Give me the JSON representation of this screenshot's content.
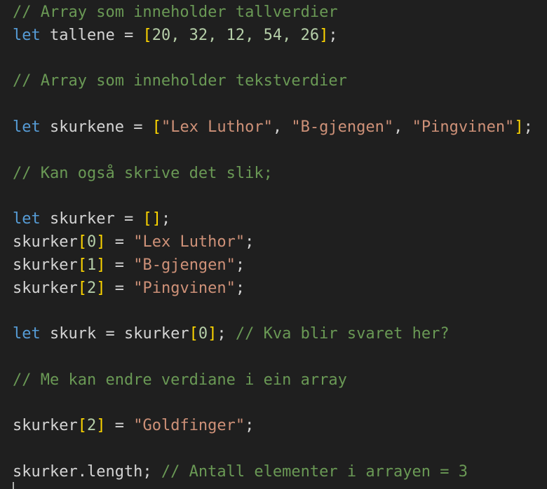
{
  "editor": {
    "lines": [
      [
        {
          "t": "// Array som inneholder tallverdier",
          "c": "cm"
        }
      ],
      [
        {
          "t": "let",
          "c": "kw"
        },
        {
          "t": " tallene = ",
          "c": "id"
        },
        {
          "t": "[",
          "c": "br"
        },
        {
          "t": "20, 32, 12, 54, 26",
          "c": "num"
        },
        {
          "t": "]",
          "c": "br"
        },
        {
          "t": ";",
          "c": "op"
        }
      ],
      [],
      [
        {
          "t": "// Array som inneholder tekstverdier",
          "c": "cm"
        }
      ],
      [],
      [
        {
          "t": "let",
          "c": "kw"
        },
        {
          "t": " skurkene = ",
          "c": "id"
        },
        {
          "t": "[",
          "c": "br"
        },
        {
          "t": "\"Lex Luthor\"",
          "c": "str"
        },
        {
          "t": ", ",
          "c": "op"
        },
        {
          "t": "\"B-gjengen\"",
          "c": "str"
        },
        {
          "t": ", ",
          "c": "op"
        },
        {
          "t": "\"Pingvinen\"",
          "c": "str"
        },
        {
          "t": "]",
          "c": "br"
        },
        {
          "t": ";",
          "c": "op"
        }
      ],
      [],
      [
        {
          "t": "// Kan også skrive det slik;",
          "c": "cm"
        }
      ],
      [],
      [
        {
          "t": "let",
          "c": "kw"
        },
        {
          "t": " skurker = ",
          "c": "id"
        },
        {
          "t": "[]",
          "c": "br"
        },
        {
          "t": ";",
          "c": "op"
        }
      ],
      [
        {
          "t": "skurker",
          "c": "id"
        },
        {
          "t": "[",
          "c": "br"
        },
        {
          "t": "0",
          "c": "num"
        },
        {
          "t": "]",
          "c": "br"
        },
        {
          "t": " = ",
          "c": "op"
        },
        {
          "t": "\"Lex Luthor\"",
          "c": "str"
        },
        {
          "t": ";",
          "c": "op"
        }
      ],
      [
        {
          "t": "skurker",
          "c": "id"
        },
        {
          "t": "[",
          "c": "br"
        },
        {
          "t": "1",
          "c": "num"
        },
        {
          "t": "]",
          "c": "br"
        },
        {
          "t": " = ",
          "c": "op"
        },
        {
          "t": "\"B-gjengen\"",
          "c": "str"
        },
        {
          "t": ";",
          "c": "op"
        }
      ],
      [
        {
          "t": "skurker",
          "c": "id"
        },
        {
          "t": "[",
          "c": "br"
        },
        {
          "t": "2",
          "c": "num"
        },
        {
          "t": "]",
          "c": "br"
        },
        {
          "t": " = ",
          "c": "op"
        },
        {
          "t": "\"Pingvinen\"",
          "c": "str"
        },
        {
          "t": ";",
          "c": "op"
        }
      ],
      [],
      [
        {
          "t": "let",
          "c": "kw"
        },
        {
          "t": " skurk = skurker",
          "c": "id"
        },
        {
          "t": "[",
          "c": "br"
        },
        {
          "t": "0",
          "c": "num"
        },
        {
          "t": "]",
          "c": "br"
        },
        {
          "t": "; ",
          "c": "op"
        },
        {
          "t": "// Kva blir svaret her?",
          "c": "cm"
        }
      ],
      [],
      [
        {
          "t": "// Me kan endre verdiane i ein array",
          "c": "cm"
        }
      ],
      [],
      [
        {
          "t": "skurker",
          "c": "id"
        },
        {
          "t": "[",
          "c": "br"
        },
        {
          "t": "2",
          "c": "num"
        },
        {
          "t": "]",
          "c": "br"
        },
        {
          "t": " = ",
          "c": "op"
        },
        {
          "t": "\"Goldfinger\"",
          "c": "str"
        },
        {
          "t": ";",
          "c": "op"
        }
      ],
      [],
      [
        {
          "t": "skurker.length; ",
          "c": "id"
        },
        {
          "t": "// Antall elementer i arrayen = 3",
          "c": "cm"
        }
      ]
    ]
  }
}
